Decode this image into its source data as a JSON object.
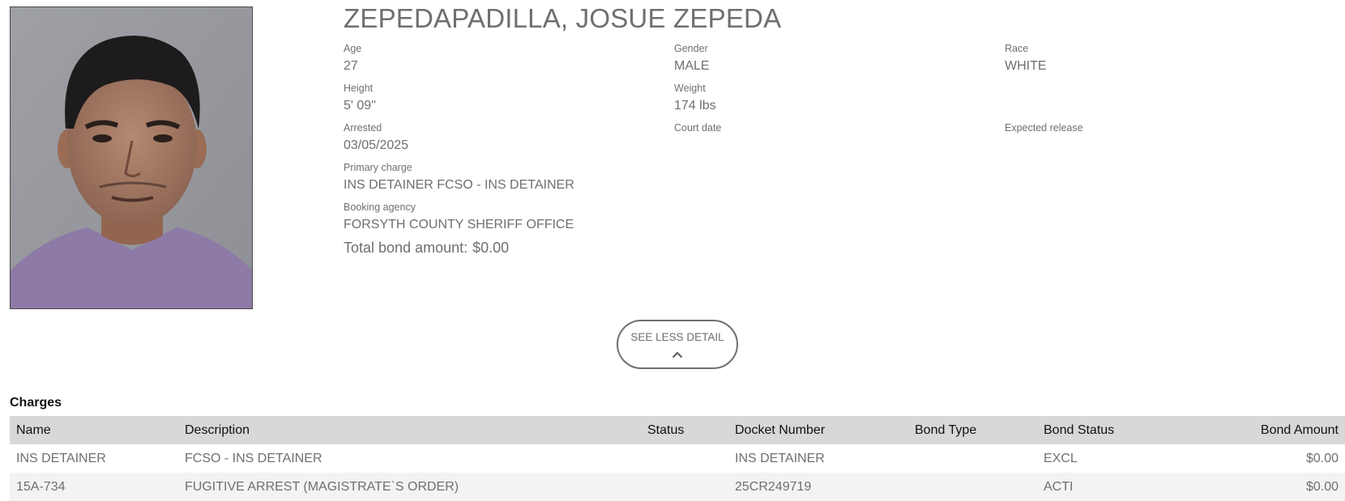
{
  "inmate": {
    "name": "ZEPEDAPADILLA, JOSUE ZEPEDA",
    "photo_alt": "Booking photo"
  },
  "details": {
    "age_label": "Age",
    "age": "27",
    "gender_label": "Gender",
    "gender": "MALE",
    "race_label": "Race",
    "race": "WHITE",
    "height_label": "Height",
    "height": "5' 09\"",
    "weight_label": "Weight",
    "weight": "174 lbs",
    "arrested_label": "Arrested",
    "arrested": "03/05/2025",
    "court_date_label": "Court date",
    "court_date": "",
    "expected_release_label": "Expected release",
    "expected_release": "",
    "primary_charge_label": "Primary charge",
    "primary_charge": "INS DETAINER FCSO - INS DETAINER",
    "booking_agency_label": "Booking agency",
    "booking_agency": "FORSYTH COUNTY SHERIFF OFFICE",
    "total_bond_label": "Total bond amount:",
    "total_bond": "$0.00"
  },
  "toggle": {
    "label": "SEE LESS DETAIL",
    "icon": "chevron-up-icon"
  },
  "charges": {
    "title": "Charges",
    "headers": [
      "Name",
      "Description",
      "Status",
      "Docket Number",
      "Bond Type",
      "Bond Status",
      "Bond Amount"
    ],
    "rows": [
      [
        "INS DETAINER",
        "FCSO - INS DETAINER",
        "",
        "INS DETAINER",
        "",
        "EXCL",
        "$0.00"
      ],
      [
        "15A-734",
        "FUGITIVE ARREST (MAGISTRATE`S ORDER)",
        "",
        "25CR249719",
        "",
        "ACTI",
        "$0.00"
      ]
    ]
  },
  "colors": {
    "text": "#6f6f6f",
    "header_bg": "#d8d8d8",
    "alt_row_bg": "#f3f3f3"
  }
}
